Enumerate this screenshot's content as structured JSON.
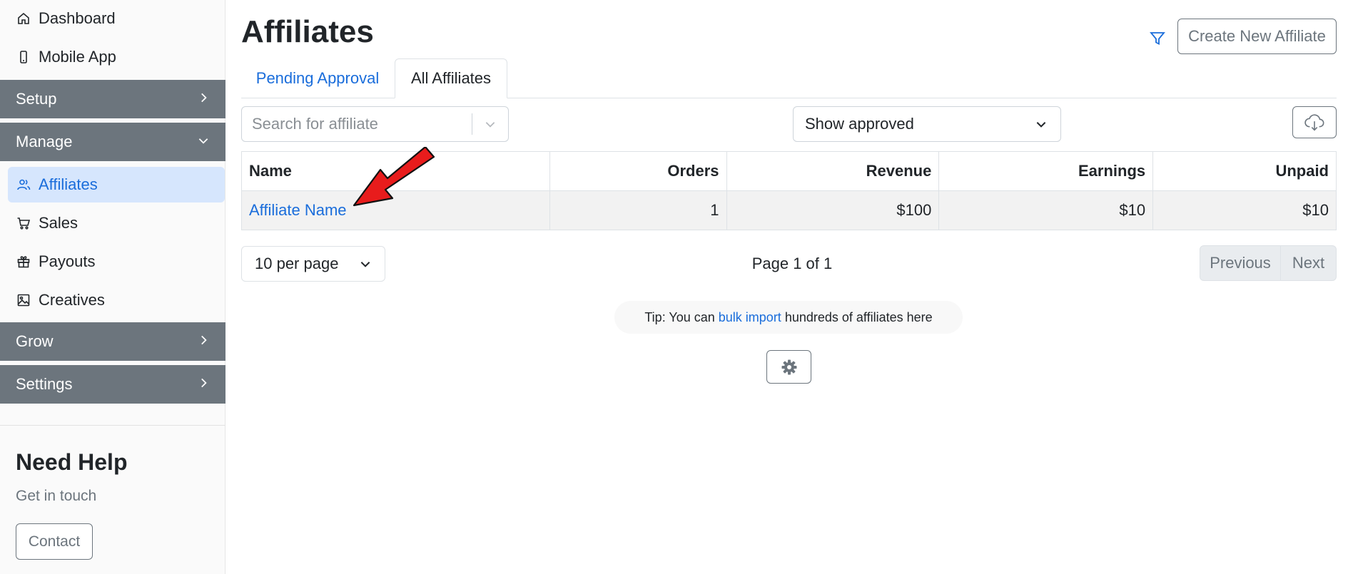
{
  "sidebar": {
    "items_top": [
      {
        "label": "Dashboard",
        "icon": "home-icon"
      },
      {
        "label": "Mobile App",
        "icon": "mobile-icon"
      }
    ],
    "sections": {
      "setup": "Setup",
      "manage": "Manage",
      "grow": "Grow",
      "settings": "Settings"
    },
    "manage_items": [
      {
        "label": "Affiliates",
        "icon": "users-icon",
        "active": true
      },
      {
        "label": "Sales",
        "icon": "cart-icon"
      },
      {
        "label": "Payouts",
        "icon": "gift-icon"
      },
      {
        "label": "Creatives",
        "icon": "image-icon"
      }
    ],
    "help": {
      "title": "Need Help",
      "subtitle": "Get in touch",
      "contact_label": "Contact"
    }
  },
  "main": {
    "title": "Affiliates",
    "create_label": "Create New Affiliate",
    "tabs": [
      {
        "label": "Pending Approval",
        "active": false
      },
      {
        "label": "All Affiliates",
        "active": true
      }
    ],
    "search": {
      "placeholder": "Search for affiliate"
    },
    "status_filter": {
      "selected": "Show approved"
    },
    "table": {
      "columns": [
        "Name",
        "Orders",
        "Revenue",
        "Earnings",
        "Unpaid"
      ],
      "rows": [
        {
          "name": "Affiliate Name",
          "orders": "1",
          "revenue": "$100",
          "earnings": "$10",
          "unpaid": "$10"
        }
      ]
    },
    "per_page": "10 per page",
    "page_info": "Page 1 of 1",
    "pager": {
      "previous": "Previous",
      "next": "Next"
    },
    "tip": {
      "prefix": "Tip: You can ",
      "link": "bulk import",
      "suffix": " hundreds of affiliates here"
    }
  },
  "colors": {
    "accent": "#1a6ddb",
    "section_bg": "#6c757d",
    "active_bg": "#d6e6fd",
    "arrow": "#e81c1c"
  }
}
